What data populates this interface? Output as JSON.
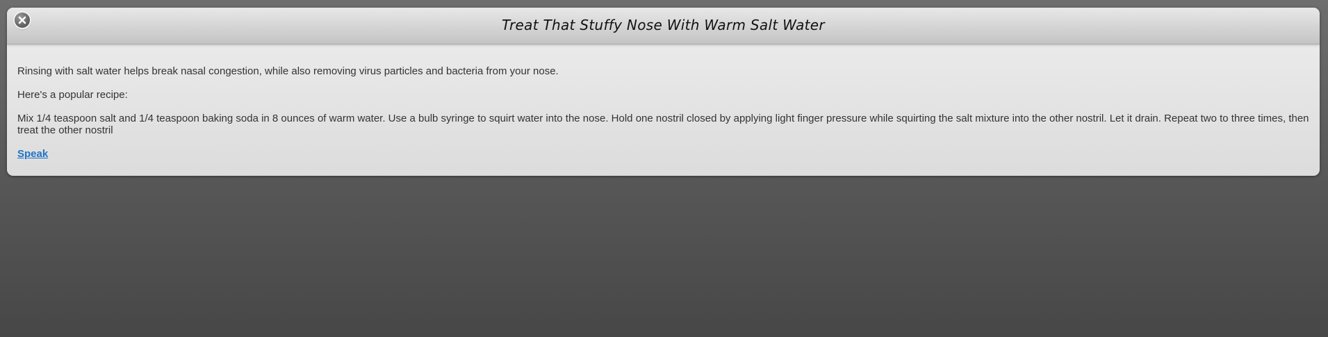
{
  "dialog": {
    "title": "Treat That Stuffy Nose With Warm Salt Water",
    "close_icon": "close-circle-icon",
    "paragraphs": [
      "Rinsing with salt water helps break nasal congestion, while also removing virus particles and bacteria from your nose.",
      "Here's a popular recipe:",
      "Mix 1/4 teaspoon salt and 1/4 teaspoon baking soda in 8 ounces of warm water. Use a bulb syringe to squirt water into the nose. Hold one nostril closed by applying light finger pressure while squirting the salt mixture into the other nostril. Let it drain. Repeat two to three times, then treat the other nostril"
    ],
    "speak_label": "Speak"
  },
  "colors": {
    "link": "#1e73c8",
    "text": "#333333",
    "background": "#4a4a4a"
  }
}
